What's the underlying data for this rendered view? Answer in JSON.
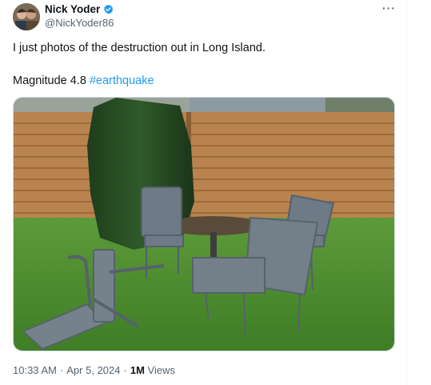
{
  "author": {
    "name": "Nick Yoder",
    "handle": "@NickYoder86"
  },
  "tweet": {
    "text": "I just photos of the destruction out in Long Island.",
    "line2_prefix": "Magnitude 4.8 ",
    "hashtag": "#earthquake"
  },
  "meta": {
    "time": "10:33 AM",
    "sep1": "·",
    "date": "Apr 5, 2024",
    "sep2": "·",
    "views_count": "1M",
    "views_label": "Views"
  },
  "icons": {
    "verified": "verified-badge-icon",
    "more": "more-horizontal-icon"
  },
  "colors": {
    "accent": "#1d9bf0",
    "secondary_text": "#536471",
    "primary_text": "#0f1419"
  }
}
